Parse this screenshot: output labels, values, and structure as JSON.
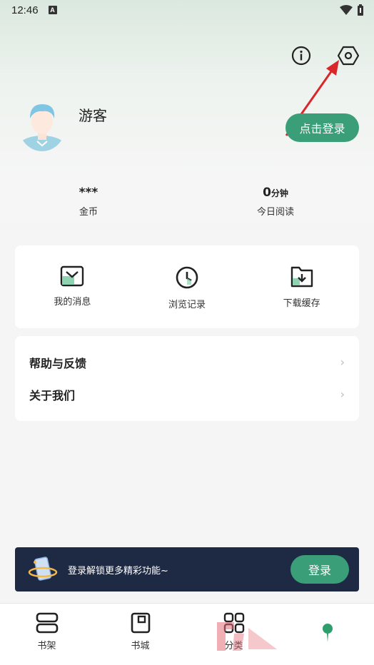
{
  "status_bar": {
    "time": "12:46",
    "notif_letter": "A"
  },
  "header": {
    "info_icon": "info-icon",
    "settings_icon": "settings-hexagon-icon"
  },
  "profile": {
    "name": "游客",
    "login_button": "点击登录"
  },
  "stats": [
    {
      "value": "***",
      "unit": "",
      "label": "金币"
    },
    {
      "value": "0",
      "unit": "分钟",
      "label": "今日阅读"
    }
  ],
  "quick_actions": [
    {
      "label": "我的消息",
      "icon": "message-icon"
    },
    {
      "label": "浏览记录",
      "icon": "clock-icon"
    },
    {
      "label": "下载缓存",
      "icon": "download-folder-icon"
    }
  ],
  "menu": [
    {
      "label": "帮助与反馈"
    },
    {
      "label": "关于我们"
    }
  ],
  "promo": {
    "text": "登录解锁更多精彩功能~",
    "button": "登录"
  },
  "bottom_nav": [
    {
      "label": "书架",
      "icon": "bookshelf-icon"
    },
    {
      "label": "书城",
      "icon": "bookstore-icon"
    },
    {
      "label": "分类",
      "icon": "category-grid-icon"
    },
    {
      "label": "",
      "icon": "profile-dot-icon"
    }
  ],
  "colors": {
    "accent": "#3a9e78",
    "promo_bg": "#1e2a44",
    "arrow": "#d9262b"
  }
}
